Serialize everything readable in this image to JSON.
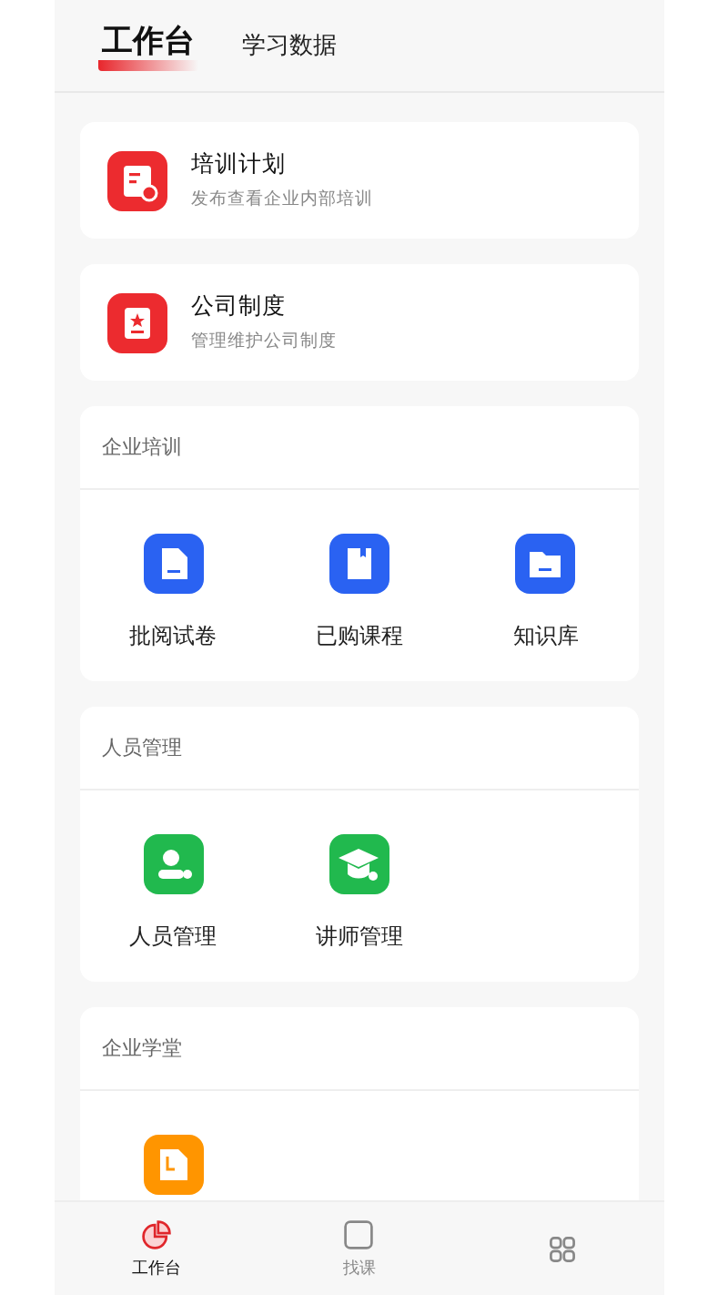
{
  "header_tabs": [
    {
      "label": "工作台",
      "selected": true
    },
    {
      "label": "学习数据",
      "selected": false
    }
  ],
  "feature_cards": [
    {
      "title": "培训计划",
      "subtitle": "发布查看企业内部培训"
    },
    {
      "title": "公司制度",
      "subtitle": "管理维护公司制度"
    }
  ],
  "sections": [
    {
      "title": "企业培训",
      "color": "#2a62f2",
      "items": [
        {
          "label": "批阅试卷"
        },
        {
          "label": "已购课程"
        },
        {
          "label": "知识库"
        }
      ]
    },
    {
      "title": "人员管理",
      "color": "#21b94e",
      "items": [
        {
          "label": "人员管理"
        },
        {
          "label": "讲师管理"
        }
      ]
    },
    {
      "title": "企业学堂",
      "color": "#ff9500",
      "items": [
        {
          "kind": "ldoc"
        }
      ]
    }
  ],
  "bottom_tabs": [
    {
      "label": "工作台",
      "selected": true
    },
    {
      "label": "找课",
      "selected": false
    },
    {
      "selected": false
    }
  ]
}
